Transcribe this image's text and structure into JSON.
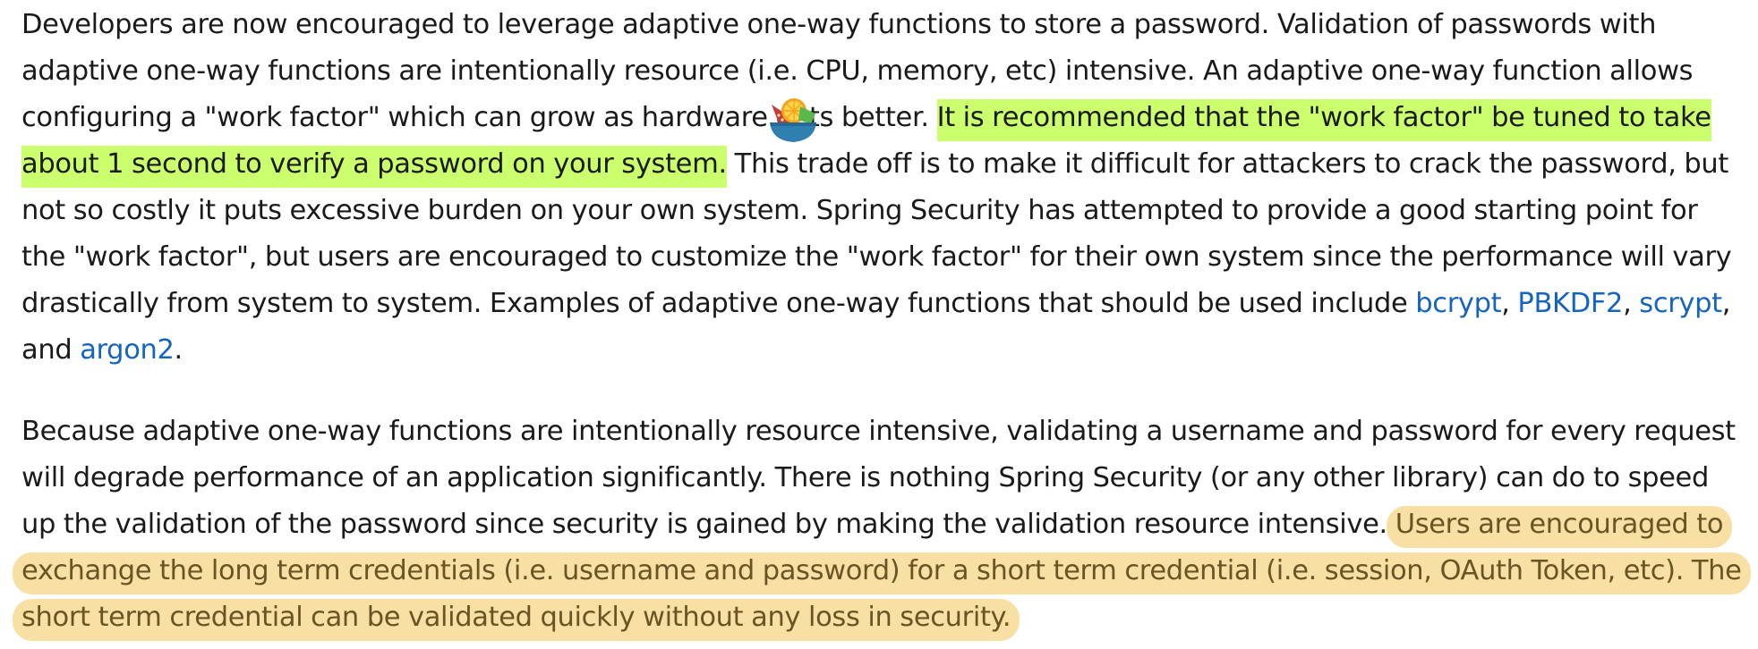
{
  "article": {
    "paragraph1": {
      "text_a": "Developers are now encouraged to leverage adaptive one-way functions to store a password. Validation of passwords with adaptive one-way functions are intentionally resource (i.e. CPU, memory, etc) intensive. An adaptive one-way function allows configuring a \"work factor\" which can grow as hardware gets better. ",
      "highlight": "It is recommended that the \"work factor\" be tuned to take about 1 second to verify a password on your system.",
      "text_b": " This trade off is to make it difficult for attackers to crack the password, but not so costly it puts excessive burden on your own system. Spring Security has attempted to provide a good starting point for the \"work factor\", but users are encouraged to customize the \"work factor\" for their own system since the performance will vary drastically from system to system. Examples of adaptive one-way functions that should be used include ",
      "links": [
        "bcrypt",
        "PBKDF2",
        "scrypt",
        "argon2"
      ],
      "sep1": ", ",
      "sep2": ", ",
      "sep3": ", and ",
      "end": "."
    },
    "paragraph2": {
      "text": "Because adaptive one-way functions are intentionally resource intensive, validating a username and password for every request will degrade performance of an application significantly. There is nothing Spring Security (or any other library) can do to speed up the validation of the password since security is gained by making the validation resource intensive. ",
      "highlight": "Users are encouraged to exchange the long term credentials (i.e. username and password) for a short term credential (i.e. session, OAuth Token, etc). The short term credential can be validated quickly without any loss in security."
    }
  },
  "colors": {
    "green_highlight": "#cbff6e",
    "orange_highlight": "#f8dfa4",
    "link": "#1565c0"
  },
  "overlay": {
    "icon": "fruit-bowl-icon"
  }
}
